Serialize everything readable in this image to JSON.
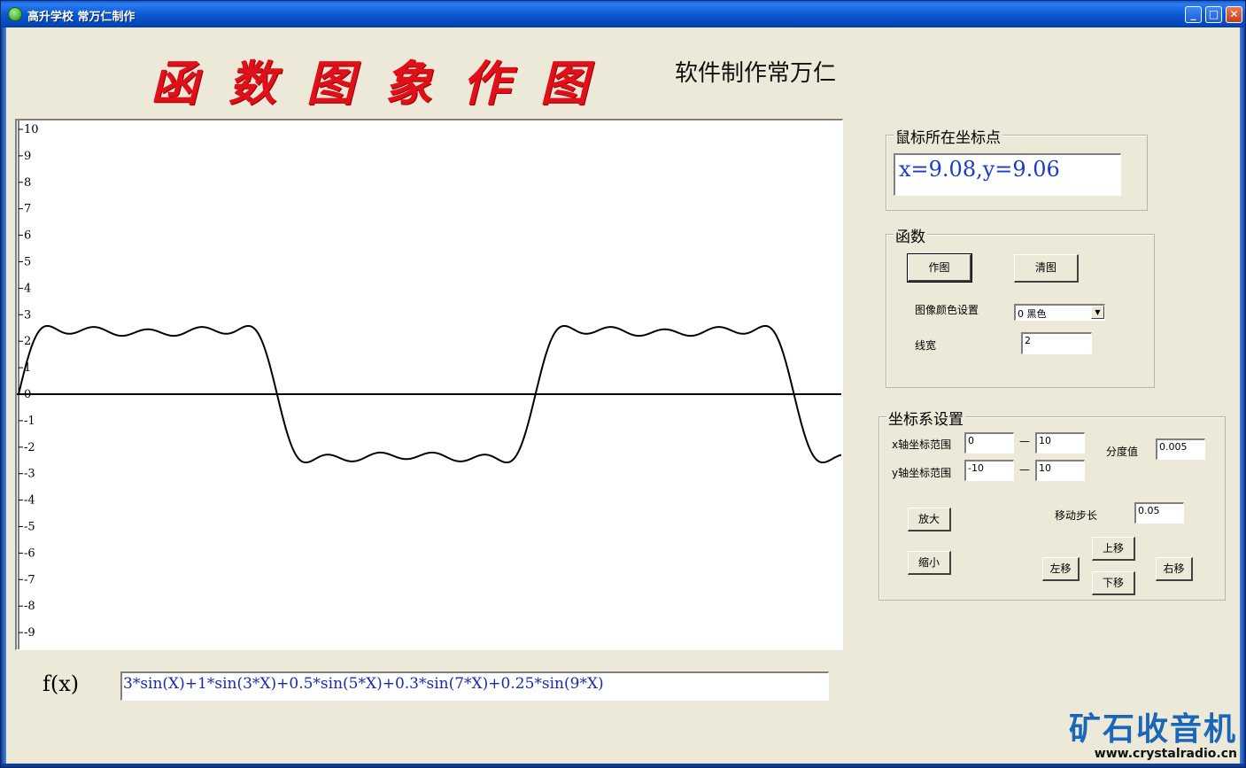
{
  "window": {
    "title": "高升学校 常万仁制作",
    "minimize": "_",
    "maximize": "□",
    "close": "✕"
  },
  "header": {
    "title": "函数图象作图",
    "subtitle": "软件制作常万仁"
  },
  "chart_data": {
    "type": "line",
    "function": "3*sin(X)+1*sin(3*X)+0.5*sin(5*X)+0.3*sin(7*X)+0.25*sin(9*X)",
    "xlim": [
      0,
      10
    ],
    "ylim": [
      -10,
      10
    ],
    "yticks": [
      "10",
      "9",
      "8",
      "7",
      "6",
      "5",
      "4",
      "3",
      "2",
      "1",
      "0",
      "-1",
      "-2",
      "-3",
      "-4",
      "-5",
      "-6",
      "-7",
      "-8",
      "-9"
    ],
    "step": 0.005,
    "line_color": "#000000",
    "line_width": 2,
    "grid": false
  },
  "mouse_panel": {
    "label": "鼠标所在坐标点",
    "value": "x=9.08,y=9.06"
  },
  "function_panel": {
    "label": "函数",
    "draw_button": "作图",
    "clear_button": "清图",
    "color_label": "图像颜色设置",
    "color_value": "0   黑色",
    "linewidth_label": "线宽",
    "linewidth_value": "2"
  },
  "axis_panel": {
    "label": "坐标系设置",
    "x_range_label": "x轴坐标范围",
    "x_min": "0",
    "x_max": "10",
    "y_range_label": "y轴坐标范围",
    "y_min": "-10",
    "y_max": "10",
    "dash": "—",
    "step_label": "分度值",
    "step_value": "0.005",
    "move_step_label": "移动步长",
    "move_step_value": "0.05",
    "zoom_in": "放大",
    "zoom_out": "缩小",
    "move_up": "上移",
    "move_left": "左移",
    "move_right": "右移",
    "move_down": "下移"
  },
  "formula": {
    "label": "f(x)",
    "value": "3*sin(X)+1*sin(3*X)+0.5*sin(5*X)+0.3*sin(7*X)+0.25*sin(9*X)"
  },
  "watermark": {
    "logo": "矿石收音机",
    "url": "www.crystalradio.cn"
  }
}
